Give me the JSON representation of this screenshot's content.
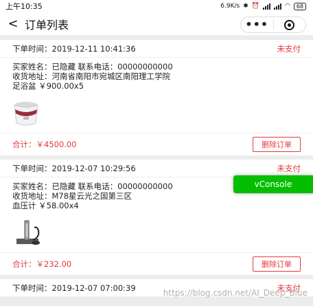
{
  "statusbar": {
    "time": "上午10:35",
    "speed": "6.9K/s",
    "battery": "68"
  },
  "nav": {
    "back_glyph": "<",
    "title": "订单列表"
  },
  "orders": [
    {
      "time_label": "下单时间：",
      "time": "2019-12-11 10:41:36",
      "status": "未支付",
      "buyer": "买家姓名：已隐藏 联系电话：00000000000",
      "address": "收货地址：河南省南阳市宛城区南阳理工学院",
      "item": "足浴盆 ￥900.00x5",
      "image": "foot-bath-image",
      "total": "合计：￥4500.00",
      "action": "删除订单"
    },
    {
      "time_label": "下单时间：",
      "time": "2019-12-07 10:29:56",
      "status": "未支付",
      "buyer": "买家姓名：已隐藏 联系电话：00000000000",
      "address": "收货地址：M78星云光之国第三区",
      "item": "血压计 ￥58.00x4",
      "image": "blood-pressure-monitor-image",
      "total": "合计：￥232.00",
      "action": "删除订单"
    },
    {
      "time_label": "下单时间：",
      "time": "2019-12-07 07:00:39",
      "status": "未支付"
    }
  ],
  "vconsole": "vConsole",
  "watermark": "https://blog.csdn.net/AI_Deep_Blue",
  "colors": {
    "accent_red": "#e4393c",
    "vconsole_green": "#04be02"
  }
}
